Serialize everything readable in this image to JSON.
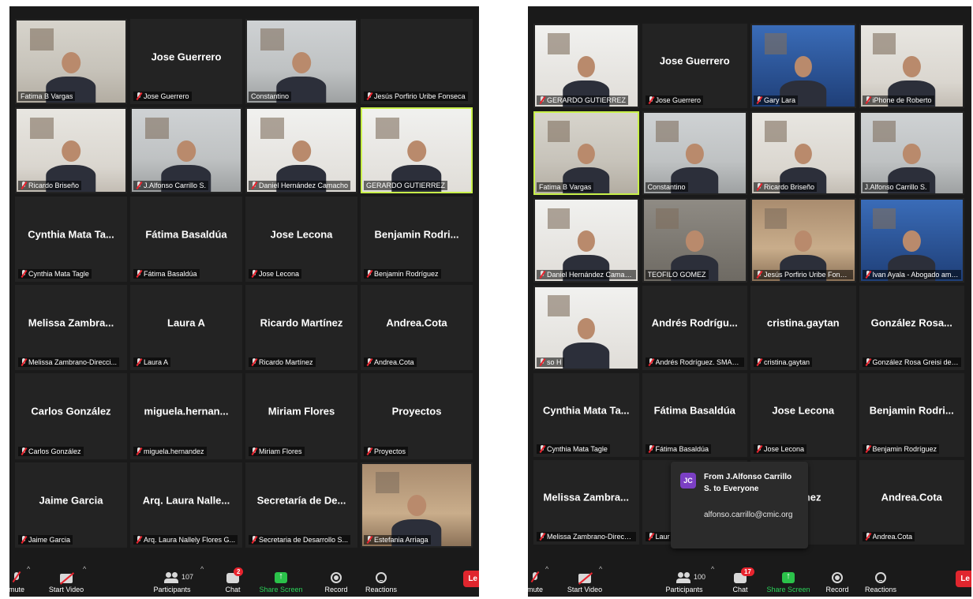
{
  "left": {
    "tiles": [
      {
        "center": "",
        "label": "Fatima B Vargas",
        "mic": false,
        "video": "room-a"
      },
      {
        "center": "Jose Guerrero",
        "label": "Jose Guerrero",
        "mic": true,
        "video": ""
      },
      {
        "center": "",
        "label": "Constantino",
        "mic": false,
        "video": "room-b"
      },
      {
        "center": "",
        "label": "Jesús Porfirio Uribe Fonseca",
        "mic": true,
        "video": ""
      },
      {
        "center": "",
        "label": "Ricardo Briseño",
        "mic": true,
        "video": "room-c"
      },
      {
        "center": "",
        "label": "J.Alfonso Carrillo S.",
        "mic": true,
        "video": "room-b"
      },
      {
        "center": "",
        "label": "Daniel Hernández Camacho",
        "mic": true,
        "video": "room-g"
      },
      {
        "center": "",
        "label": "GERARDO GUTIERREZ",
        "mic": false,
        "video": "room-g",
        "active": true
      },
      {
        "center": "Cynthia Mata Ta...",
        "label": "Cynthia Mata Tagle",
        "mic": true,
        "video": ""
      },
      {
        "center": "Fátima Basaldúa",
        "label": "Fátima Basaldúa",
        "mic": true,
        "video": ""
      },
      {
        "center": "Jose Lecona",
        "label": "Jose Lecona",
        "mic": true,
        "video": ""
      },
      {
        "center": "Benjamin Rodri...",
        "label": "Benjamin Rodríguez",
        "mic": true,
        "video": ""
      },
      {
        "center": "Melissa Zambra...",
        "label": "Melissa Zambrano-Direcci...",
        "mic": true,
        "video": ""
      },
      {
        "center": "Laura A",
        "label": "Laura A",
        "mic": true,
        "video": ""
      },
      {
        "center": "Ricardo Martínez",
        "label": "Ricardo Martínez",
        "mic": true,
        "video": ""
      },
      {
        "center": "Andrea.Cota",
        "label": "Andrea.Cota",
        "mic": true,
        "video": ""
      },
      {
        "center": "Carlos González",
        "label": "Carlos González",
        "mic": true,
        "video": ""
      },
      {
        "center": "miguela.hernan...",
        "label": "miguela.hernandez",
        "mic": true,
        "video": ""
      },
      {
        "center": "Miriam Flores",
        "label": "Miriam Flores",
        "mic": true,
        "video": ""
      },
      {
        "center": "Proyectos",
        "label": "Proyectos",
        "mic": true,
        "video": ""
      },
      {
        "center": "Jaime Garcia",
        "label": "Jaime Garcia",
        "mic": true,
        "video": ""
      },
      {
        "center": "Arq. Laura Nalle...",
        "label": "Arq. Laura Nallely Flores G...",
        "mic": true,
        "video": ""
      },
      {
        "center": "Secretaría de De...",
        "label": "Secretaria de Desarrollo S...",
        "mic": true,
        "video": ""
      },
      {
        "center": "",
        "label": "Estefania Arriaga",
        "mic": true,
        "video": "room-e"
      }
    ],
    "toolbar": {
      "mute": "mute",
      "start_video": "Start Video",
      "participants": "Participants",
      "participants_count": "107",
      "chat": "Chat",
      "chat_badge": "2",
      "share": "Share Screen",
      "record": "Record",
      "reactions": "Reactions",
      "leave": "Le"
    }
  },
  "right": {
    "tiles": [
      {
        "center": "",
        "label": "GERARDO GUTIERREZ",
        "mic": true,
        "video": "room-g"
      },
      {
        "center": "Jose Guerrero",
        "label": "Jose Guerrero",
        "mic": true,
        "video": ""
      },
      {
        "center": "",
        "label": "Gary Lara",
        "mic": true,
        "video": "room-f"
      },
      {
        "center": "",
        "label": "iPhone de Roberto",
        "mic": true,
        "video": "room-c"
      },
      {
        "center": "",
        "label": "Fatima B Vargas",
        "mic": false,
        "video": "room-a",
        "active": true
      },
      {
        "center": "",
        "label": "Constantino",
        "mic": false,
        "video": "room-b"
      },
      {
        "center": "",
        "label": "Ricardo Briseño",
        "mic": true,
        "video": "room-c"
      },
      {
        "center": "",
        "label": "J.Alfonso Carrillo S.",
        "mic": false,
        "video": "room-b"
      },
      {
        "center": "",
        "label": "Daniel Hernández Camacho",
        "mic": true,
        "video": "room-g"
      },
      {
        "center": "",
        "label": "TEOFILO GOMEZ",
        "mic": false,
        "video": "room-d"
      },
      {
        "center": "",
        "label": "Jesús Porfirio Uribe Fonseca",
        "mic": true,
        "video": "room-e"
      },
      {
        "center": "",
        "label": "Ivan Ayala - Abogado amb...",
        "mic": true,
        "video": "room-f"
      },
      {
        "center": "",
        "label": "so H",
        "mic": true,
        "video": "room-g"
      },
      {
        "center": "Andrés Rodrígu...",
        "label": "Andrés Rodríguez. SMADS...",
        "mic": true,
        "video": ""
      },
      {
        "center": "cristina.gaytan",
        "label": "cristina.gaytan",
        "mic": true,
        "video": ""
      },
      {
        "center": "González Rosa...",
        "label": "González Rosa Greisi de la...",
        "mic": true,
        "video": ""
      },
      {
        "center": "Cynthia Mata Ta...",
        "label": "Cynthia Mata Tagle",
        "mic": true,
        "video": ""
      },
      {
        "center": "Fátima Basaldúa",
        "label": "Fátima Basaldúa",
        "mic": true,
        "video": ""
      },
      {
        "center": "Jose Lecona",
        "label": "Jose Lecona",
        "mic": true,
        "video": ""
      },
      {
        "center": "Benjamin Rodri...",
        "label": "Benjamin Rodríguez",
        "mic": true,
        "video": ""
      },
      {
        "center": "Melissa Zambra...",
        "label": "Melissa Zambrano-Direcci...",
        "mic": true,
        "video": ""
      },
      {
        "center": "",
        "label": "Laur",
        "mic": true,
        "video": ""
      },
      {
        "center": "lartinez",
        "label": "nez",
        "mic": false,
        "video": ""
      },
      {
        "center": "Andrea.Cota",
        "label": "Andrea.Cota",
        "mic": true,
        "video": ""
      }
    ],
    "toolbar": {
      "mute": "mute",
      "start_video": "Start Video",
      "participants": "Participants",
      "participants_count": "100",
      "chat": "Chat",
      "chat_badge": "17",
      "share": "Share Screen",
      "record": "Record",
      "reactions": "Reactions",
      "leave": "Le"
    },
    "chat_popup": {
      "avatar": "JC",
      "from": "From J.Alfonso Carrillo S. to Everyone",
      "message": "alfonso.carrillo@cmic.org"
    }
  },
  "colors": {
    "active_border": "#c8f04a",
    "share_green": "#2bc24a",
    "leave_red": "#e0262e",
    "badge_red": "#e8242e",
    "avatar_purple": "#7b3fc4"
  }
}
